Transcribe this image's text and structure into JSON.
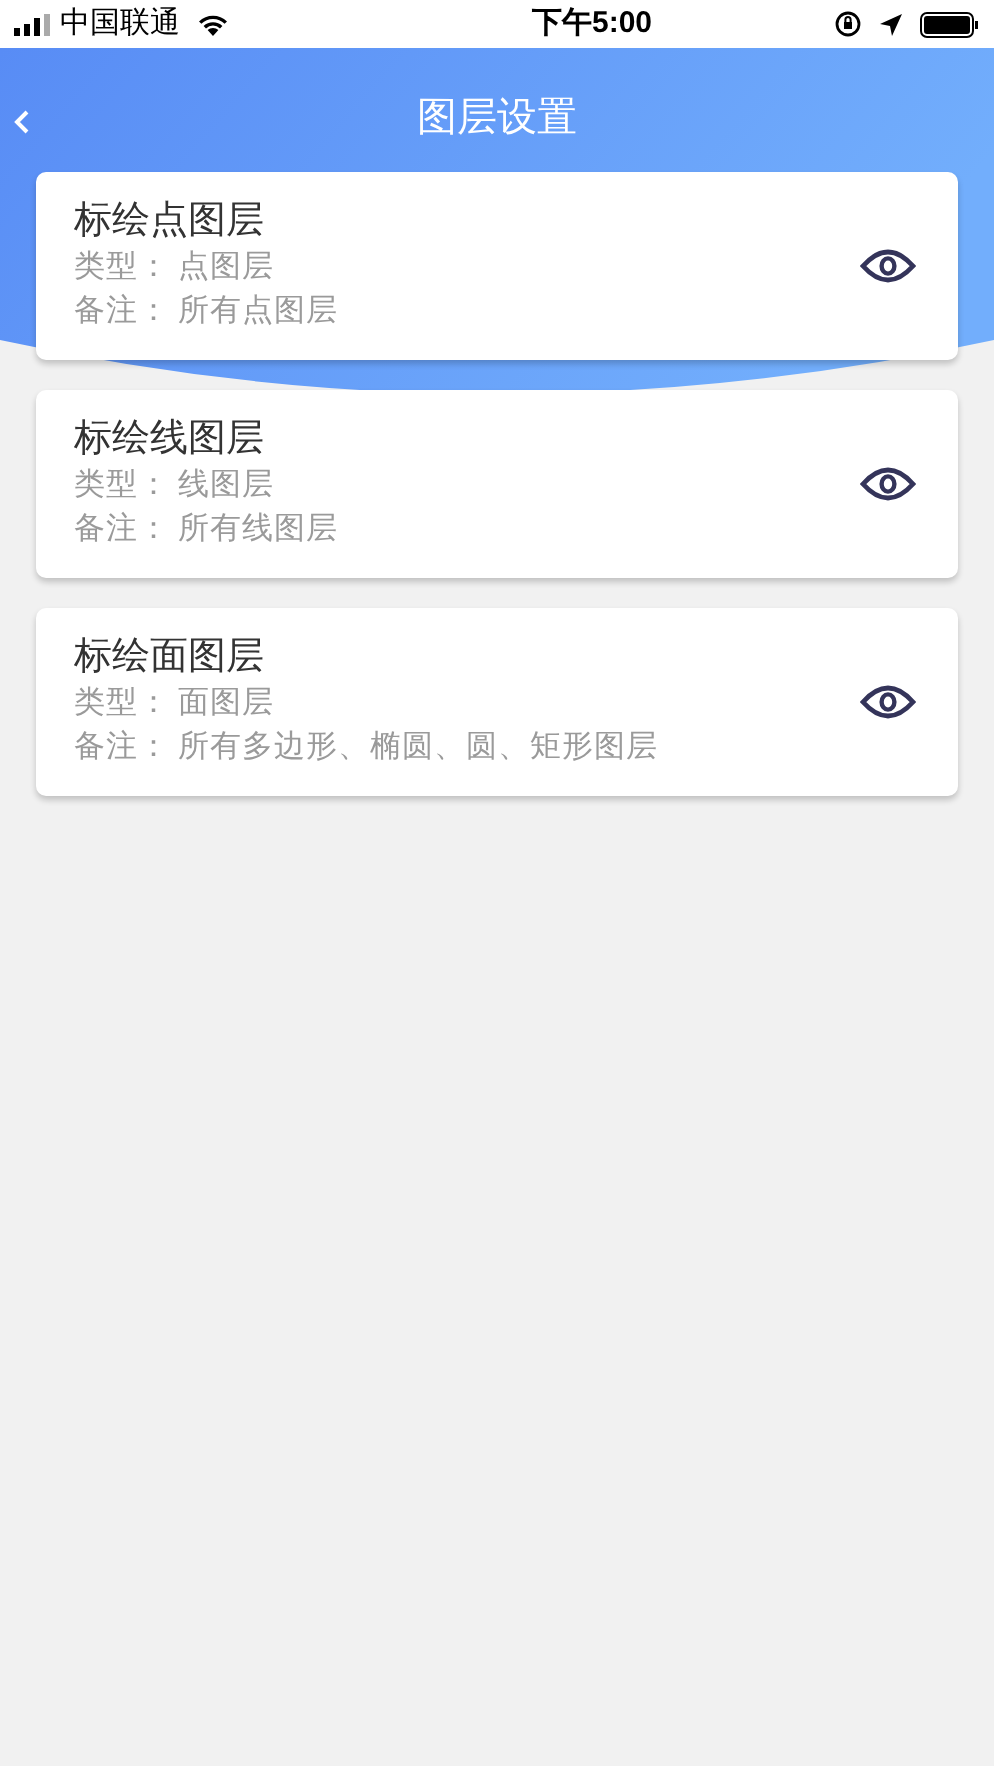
{
  "status_bar": {
    "carrier": "中国联通",
    "time": "下午5:00"
  },
  "nav": {
    "title": "图层设置"
  },
  "layers": [
    {
      "name": "标绘点图层",
      "type_label": "类型：",
      "type": "点图层",
      "note_label": "备注：",
      "note": "所有点图层"
    },
    {
      "name": "标绘线图层",
      "type_label": "类型：",
      "type": "线图层",
      "note_label": "备注：",
      "note": "所有线图层"
    },
    {
      "name": "标绘面图层",
      "type_label": "类型：",
      "type": "面图层",
      "note_label": "备注：",
      "note": "所有多边形、椭圆、圆、矩形图层"
    }
  ]
}
